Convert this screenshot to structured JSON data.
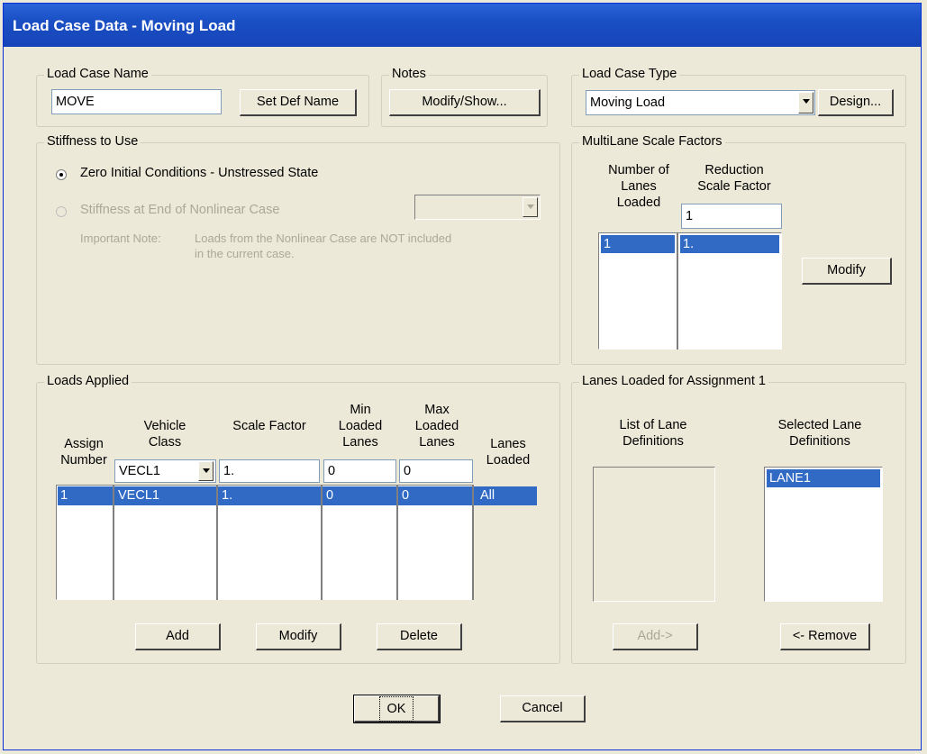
{
  "window": {
    "title": "Load Case Data - Moving Load"
  },
  "load_case_name": {
    "label": "Load Case Name",
    "value": "MOVE",
    "set_def_name": "Set Def Name"
  },
  "notes": {
    "label": "Notes",
    "button": "Modify/Show..."
  },
  "load_case_type": {
    "label": "Load Case Type",
    "value": "Moving Load",
    "design": "Design..."
  },
  "stiffness": {
    "label": "Stiffness to Use",
    "option1": "Zero Initial Conditions - Unstressed State",
    "option2": "Stiffness at End of Nonlinear Case",
    "note_label": "Important Note:",
    "note_line1": "Loads from the Nonlinear Case are NOT included",
    "note_line2": "in the current case."
  },
  "multilane": {
    "label": "MultiLane Scale Factors",
    "col1": [
      "Number of",
      "Lanes",
      "Loaded"
    ],
    "col2": [
      "Reduction",
      "Scale Factor"
    ],
    "input_value": "1",
    "rows": [
      {
        "lanes": "1",
        "factor": "1."
      }
    ],
    "modify": "Modify"
  },
  "loads_applied": {
    "label": "Loads Applied",
    "headers": {
      "assign": [
        "Assign",
        "Number"
      ],
      "vehicle": [
        "Vehicle",
        "Class"
      ],
      "scale": "Scale Factor",
      "min": [
        "Min",
        "Loaded",
        "Lanes"
      ],
      "max": [
        "Max",
        "Loaded",
        "Lanes"
      ],
      "lanes": [
        "Lanes",
        "Loaded"
      ]
    },
    "inputs": {
      "vehicle": "VECL1",
      "scale": "1.",
      "min": "0",
      "max": "0"
    },
    "rows": [
      {
        "assign": "1",
        "vehicle": "VECL1",
        "scale": "1.",
        "min": "0",
        "max": "0",
        "lanes": "All"
      }
    ],
    "add": "Add",
    "modify": "Modify",
    "delete": "Delete"
  },
  "lanes_loaded": {
    "label": "Lanes Loaded for Assignment 1",
    "list_label": [
      "List of Lane",
      "Definitions"
    ],
    "selected_label": [
      "Selected Lane",
      "Definitions"
    ],
    "selected_items": [
      "LANE1"
    ],
    "add": "Add->",
    "remove": "<- Remove"
  },
  "footer": {
    "ok": "OK",
    "cancel": "Cancel"
  }
}
